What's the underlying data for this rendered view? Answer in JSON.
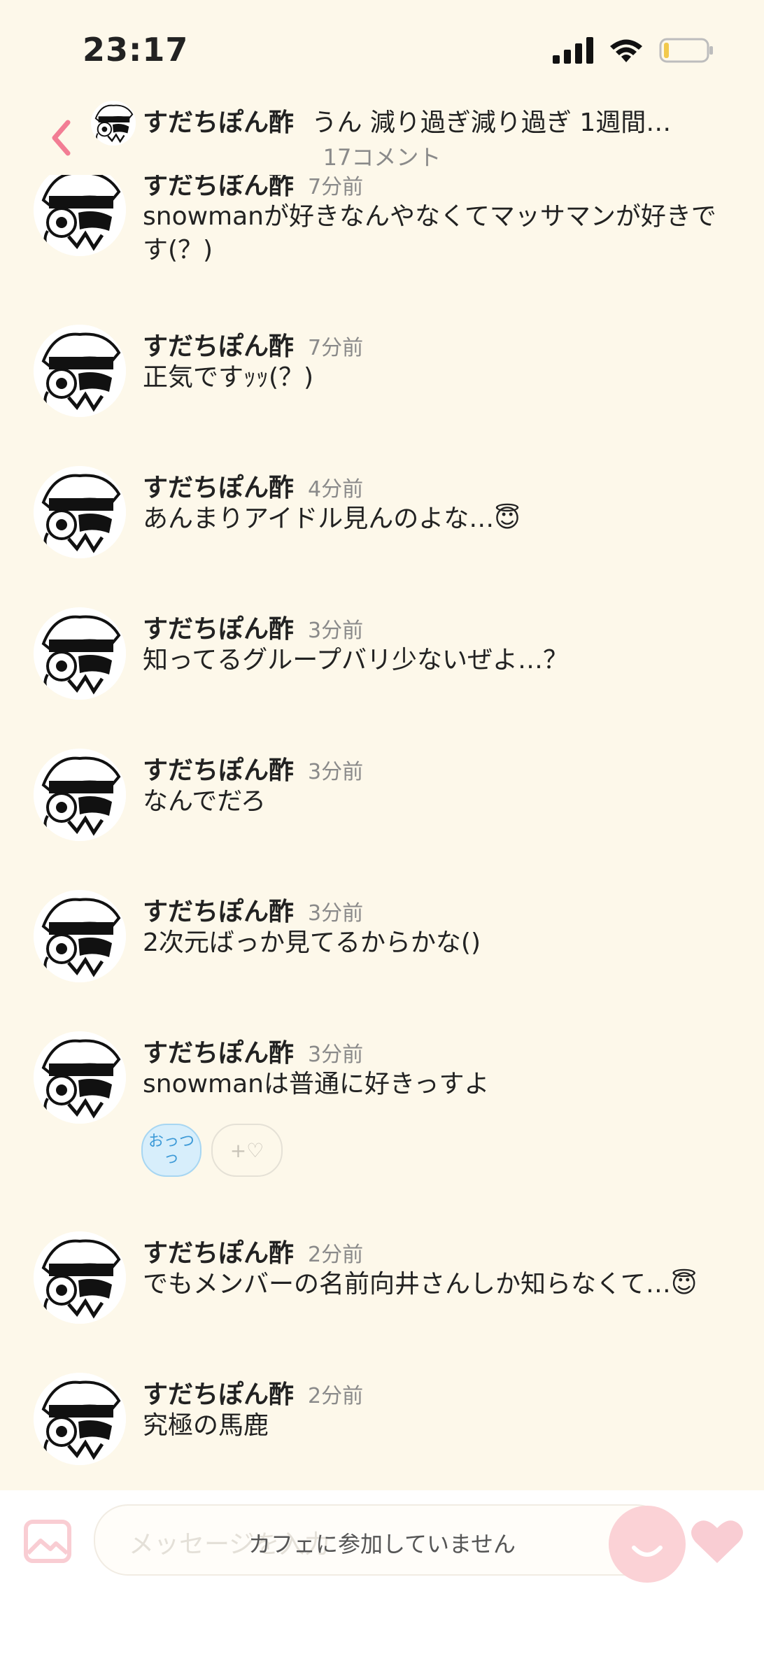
{
  "status_bar": {
    "time": "23:17"
  },
  "header": {
    "author": "すだちぽん酢",
    "snippet": "うん 減り過ぎ減り過ぎ 1週間…",
    "comment_count": "17コメント"
  },
  "comments": [
    {
      "author": "すだちぽん酢",
      "time": "7分前",
      "text": "snowmanが好きなんやなくてマッサマンが好きです(？)"
    },
    {
      "author": "すだちぽん酢",
      "time": "7分前",
      "text": "正気ですｯｯ(？)"
    },
    {
      "author": "すだちぽん酢",
      "time": "4分前",
      "text": "あんまりアイドル見んのよな…😇"
    },
    {
      "author": "すだちぽん酢",
      "time": "3分前",
      "text": "知ってるグループバリ少ないぜよ…？"
    },
    {
      "author": "すだちぽん酢",
      "time": "3分前",
      "text": "なんでだろ"
    },
    {
      "author": "すだちぽん酢",
      "time": "3分前",
      "text": "2次元ばっか見てるからかな()"
    },
    {
      "author": "すだちぽん酢",
      "time": "3分前",
      "text": "snowmanは普通に好きっすよ",
      "reaction_label": "おっつっ",
      "add_reaction_label": "+♡"
    },
    {
      "author": "すだちぽん酢",
      "time": "2分前",
      "text": "でもメンバーの名前向井さんしか知らなくて…😇"
    },
    {
      "author": "すだちぽん酢",
      "time": "2分前",
      "text": "究極の馬鹿"
    }
  ],
  "composer": {
    "placeholder": "メッセージを入力",
    "notice": "カフェに参加していません"
  },
  "colors": {
    "background": "#fdf8ea",
    "accent_pink": "#f27d94",
    "muted_text": "#8a8a8a"
  },
  "icons": {
    "back": "chevron-left-icon",
    "signal": "signal-bars-icon",
    "wifi": "wifi-icon",
    "battery": "battery-icon",
    "image": "image-icon",
    "emoji": "emoji-icon",
    "heart": "heart-icon"
  }
}
